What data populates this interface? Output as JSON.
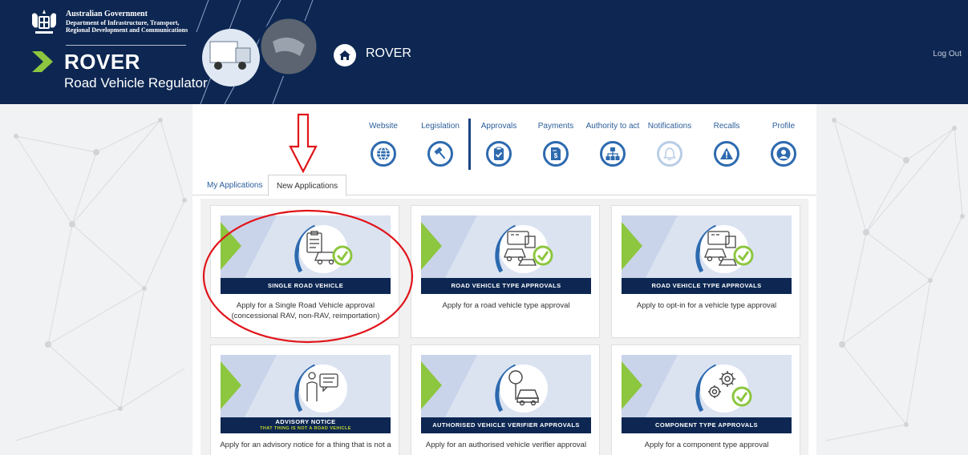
{
  "header": {
    "gov_line1": "Australian Government",
    "gov_line2": "Department of Infrastructure, Transport,",
    "gov_line3": "Regional Development and Communications",
    "brand_title": "ROVER",
    "brand_subtitle": "Road Vehicle Regulator",
    "home_title": "ROVER",
    "logout_label": "Log Out"
  },
  "nav": {
    "items": [
      {
        "label": "Website",
        "icon": "globe-icon"
      },
      {
        "label": "Legislation",
        "icon": "gavel-icon"
      },
      {
        "label": "Approvals",
        "icon": "clipboard-check-icon"
      },
      {
        "label": "Payments",
        "icon": "invoice-icon"
      },
      {
        "label": "Authority to act",
        "icon": "org-chart-icon"
      },
      {
        "label": "Notifications",
        "icon": "bell-icon",
        "disabled": true
      },
      {
        "label": "Recalls",
        "icon": "warning-icon"
      },
      {
        "label": "Profile",
        "icon": "user-icon"
      }
    ]
  },
  "tabs": [
    {
      "label": "My Applications",
      "active": false
    },
    {
      "label": "New Applications",
      "active": true
    }
  ],
  "cards": [
    {
      "banner": "SINGLE ROAD VEHICLE",
      "desc": "Apply for a Single Road Vehicle approval (concessional RAV, non-RAV, reimportation)"
    },
    {
      "banner": "ROAD VEHICLE TYPE APPROVALS",
      "desc": "Apply for a road vehicle type approval"
    },
    {
      "banner": "ROAD VEHICLE TYPE APPROVALS",
      "desc": "Apply to opt-in for a vehicle type approval"
    },
    {
      "banner": "ADVISORY NOTICE",
      "banner_sub": "THAT THING IS NOT A ROAD VEHICLE",
      "desc": "Apply for an advisory notice for a thing that is not a"
    },
    {
      "banner": "AUTHORISED VEHICLE VERIFIER APPROVALS",
      "desc": "Apply for an authorised vehicle verifier approval"
    },
    {
      "banner": "COMPONENT TYPE APPROVALS",
      "desc": "Apply for a component type approval"
    }
  ],
  "colors": {
    "header_bg": "#0d2752",
    "accent_blue": "#2d6aaf",
    "accent_green": "#8dc63f",
    "annotation_red": "#e0141a"
  }
}
